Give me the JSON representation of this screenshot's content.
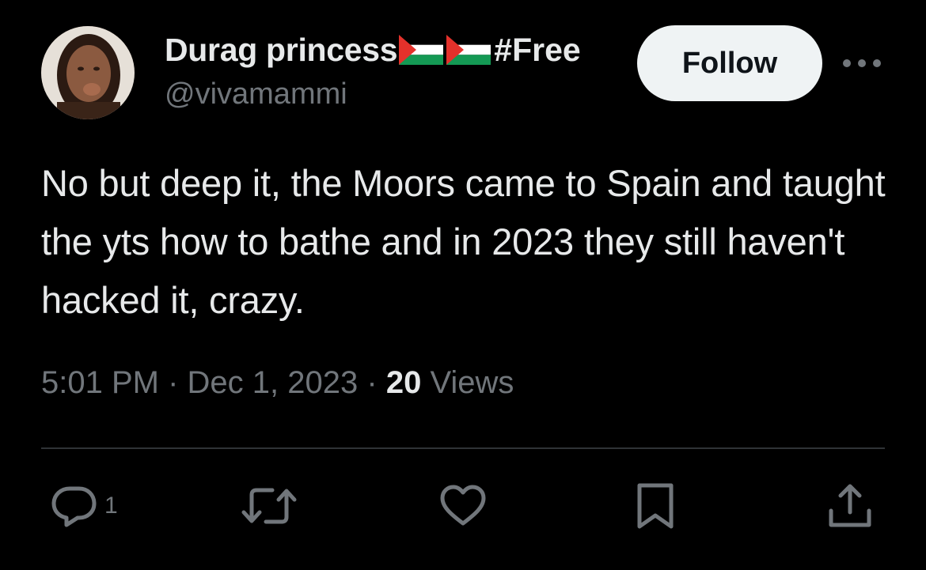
{
  "author": {
    "display_name": "Durag princess",
    "hashtag": "#Free",
    "handle": "@vivamammi",
    "flag_icons": [
      "palestine-flag-icon",
      "palestine-flag-icon"
    ]
  },
  "follow_button": {
    "label": "Follow"
  },
  "more_icon": "more-options-icon",
  "tweet": {
    "text": "No but deep it, the Moors came to Spain and taught the yts how to bathe and in 2023 they still haven't hacked it, crazy."
  },
  "meta": {
    "time": "5:01 PM",
    "separator": "·",
    "date": "Dec 1, 2023",
    "views_count": "20",
    "views_label": "Views"
  },
  "actions": {
    "reply_count": "1",
    "icons": [
      "reply-icon",
      "retweet-icon",
      "like-icon",
      "bookmark-icon",
      "share-icon"
    ]
  },
  "colors": {
    "background": "#000000",
    "text_primary": "#e7e9ea",
    "text_secondary": "#71767b",
    "divider": "#2f3336",
    "follow_bg": "#eff3f4",
    "flag_red": "#e4312b",
    "flag_green": "#149954"
  }
}
